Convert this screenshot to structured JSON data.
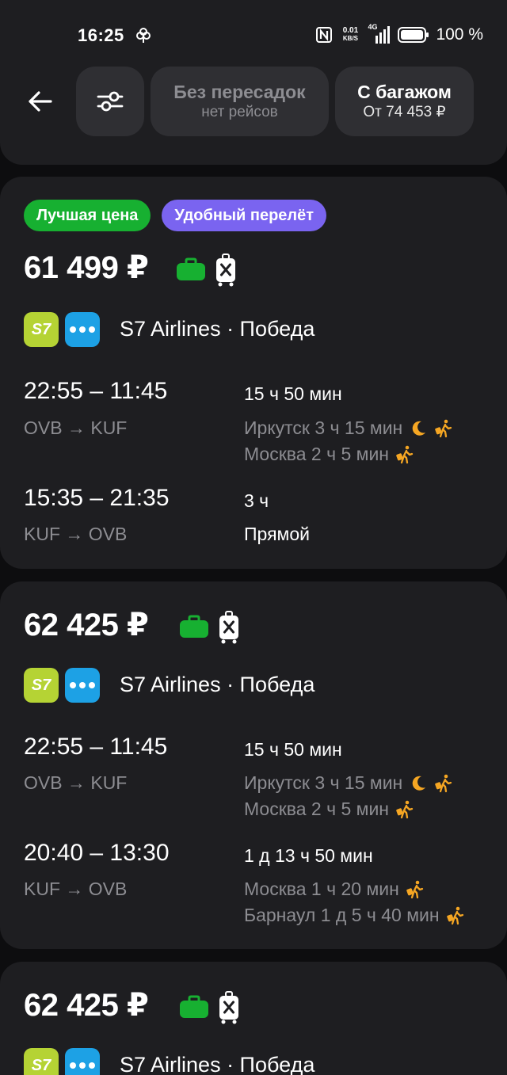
{
  "status_bar": {
    "time": "16:25",
    "net_speed": "0.01",
    "net_unit": "KB/S",
    "net_type": "4G",
    "battery": "100 %"
  },
  "header": {
    "filter_chips": [
      {
        "title": "Без пересадок",
        "subtitle": "нет рейсов",
        "state": "disabled"
      },
      {
        "title": "С багажом",
        "subtitle": "От 74 453 ₽",
        "state": "enabled"
      }
    ]
  },
  "colors": {
    "background": "#0d0d0f",
    "card": "#1e1e21",
    "chip": "#2f2f33",
    "badge_best_price": "#17b031",
    "badge_convenient": "#7a64f0",
    "bag_included": "#17b031",
    "stop_icon": "#f5a623",
    "muted_text": "#8d8d92",
    "s7_logo": "#b5d334",
    "pobeda_logo": "#1da1e5"
  },
  "icons": [
    "back-arrow-icon",
    "sliders-icon",
    "bag-icon",
    "luggage-crossed-icon",
    "moon-icon",
    "walking-traveler-icon"
  ],
  "cards": [
    {
      "badges": [
        "Лучшая цена",
        "Удобный перелёт"
      ],
      "price": "61 499 ₽",
      "airlines": "S7 Airlines · Победа",
      "logos": [
        "S7",
        "Победа"
      ],
      "legs": [
        {
          "times": "22:55 – 11:45",
          "route": "OVB → KUF",
          "duration": "15 ч 50 мин",
          "stops": [
            {
              "text": "Иркутск 3 ч 15 мин",
              "night": true
            },
            {
              "text": "Москва 2 ч 5 мин",
              "night": false
            }
          ]
        },
        {
          "times": "15:35 – 21:35",
          "route": "KUF → OVB",
          "duration": "3 ч",
          "direct": "Прямой"
        }
      ]
    },
    {
      "price": "62 425 ₽",
      "airlines": "S7 Airlines · Победа",
      "legs": [
        {
          "times": "22:55 – 11:45",
          "route": "OVB → KUF",
          "duration": "15 ч 50 мин",
          "stops": [
            {
              "text": "Иркутск 3 ч 15 мин",
              "night": true
            },
            {
              "text": "Москва 2 ч 5 мин",
              "night": false
            }
          ]
        },
        {
          "times": "20:40 – 13:30",
          "route": "KUF → OVB",
          "duration": "1 д 13 ч 50 мин",
          "stops": [
            {
              "text": "Москва 1 ч 20 мин",
              "night": false
            },
            {
              "text": "Барнаул 1 д 5 ч 40 мин",
              "night": false
            }
          ]
        }
      ]
    },
    {
      "price": "62 425 ₽",
      "airlines": "S7 Airlines · Победа"
    }
  ]
}
